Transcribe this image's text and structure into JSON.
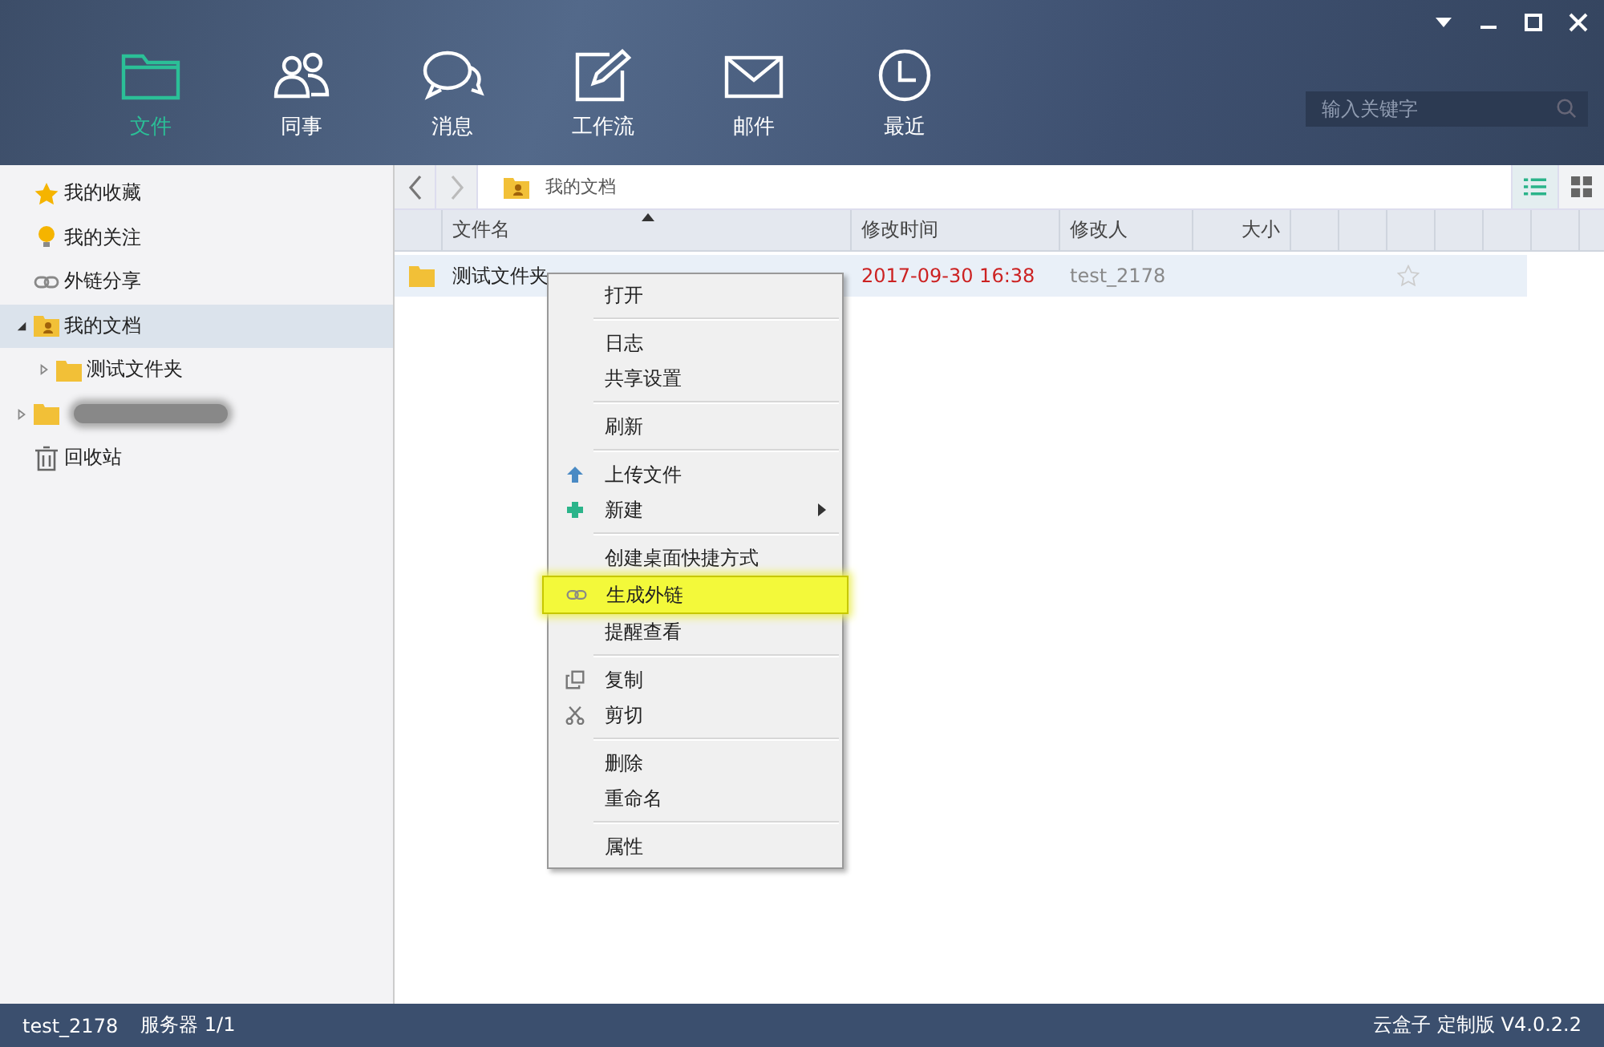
{
  "nav": [
    {
      "label": "文件",
      "selected": true
    },
    {
      "label": "同事",
      "selected": false
    },
    {
      "label": "消息",
      "selected": false
    },
    {
      "label": "工作流",
      "selected": false
    },
    {
      "label": "邮件",
      "selected": false
    },
    {
      "label": "最近",
      "selected": false
    }
  ],
  "search": {
    "placeholder": "输入关键字"
  },
  "sidebar": {
    "items": [
      {
        "label": "我的收藏",
        "kind": "star",
        "selected": false
      },
      {
        "label": "我的关注",
        "kind": "bulb",
        "selected": false
      },
      {
        "label": "外链分享",
        "kind": "link",
        "selected": false
      },
      {
        "label": "我的文档",
        "kind": "mydocs",
        "selected": true,
        "expanded": true,
        "children": [
          {
            "label": "测试文件夹",
            "kind": "folder",
            "selected": false,
            "expanded": false
          }
        ]
      },
      {
        "kind": "blurred",
        "selected": false,
        "expanded": false
      },
      {
        "label": "回收站",
        "kind": "trash",
        "selected": false
      }
    ]
  },
  "path": {
    "label": "我的文档"
  },
  "view": {
    "list_selected": true
  },
  "table": {
    "columns": [
      {
        "label": "文件名",
        "sorted": true
      },
      {
        "label": "修改时间",
        "sorted": false
      },
      {
        "label": "修改人",
        "sorted": false
      },
      {
        "label": "大小",
        "sorted": false
      }
    ],
    "rows": [
      {
        "name": "测试文件夹",
        "modified": "2017-09-30 16:38",
        "modifier": "test_2178",
        "starred": false,
        "selected": true
      }
    ]
  },
  "context_menu": {
    "groups": [
      [
        {
          "label": "打开",
          "kind": "plain",
          "selected": false
        }
      ],
      [
        {
          "label": "日志",
          "kind": "plain",
          "selected": false
        },
        {
          "label": "共享设置",
          "kind": "plain",
          "selected": false
        }
      ],
      [
        {
          "label": "刷新",
          "kind": "plain",
          "selected": false
        }
      ],
      [
        {
          "label": "上传文件",
          "kind": "upload",
          "selected": false
        },
        {
          "label": "新建",
          "kind": "new",
          "selected": false,
          "submenu": true
        }
      ],
      [
        {
          "label": "创建桌面快捷方式",
          "kind": "plain",
          "selected": false
        },
        {
          "label": "生成外链",
          "kind": "link",
          "selected": true
        },
        {
          "label": "提醒查看",
          "kind": "plain",
          "selected": false
        }
      ],
      [
        {
          "label": "复制",
          "kind": "copy",
          "selected": false
        },
        {
          "label": "剪切",
          "kind": "cut",
          "selected": false
        }
      ],
      [
        {
          "label": "删除",
          "kind": "plain",
          "selected": false
        },
        {
          "label": "重命名",
          "kind": "plain",
          "selected": false
        }
      ],
      [
        {
          "label": "属性",
          "kind": "plain",
          "selected": false
        }
      ]
    ]
  },
  "status_bar": {
    "user": "test_2178",
    "server": "服务器 1/1",
    "version": "云盒子 定制版 V4.0.2.2"
  }
}
